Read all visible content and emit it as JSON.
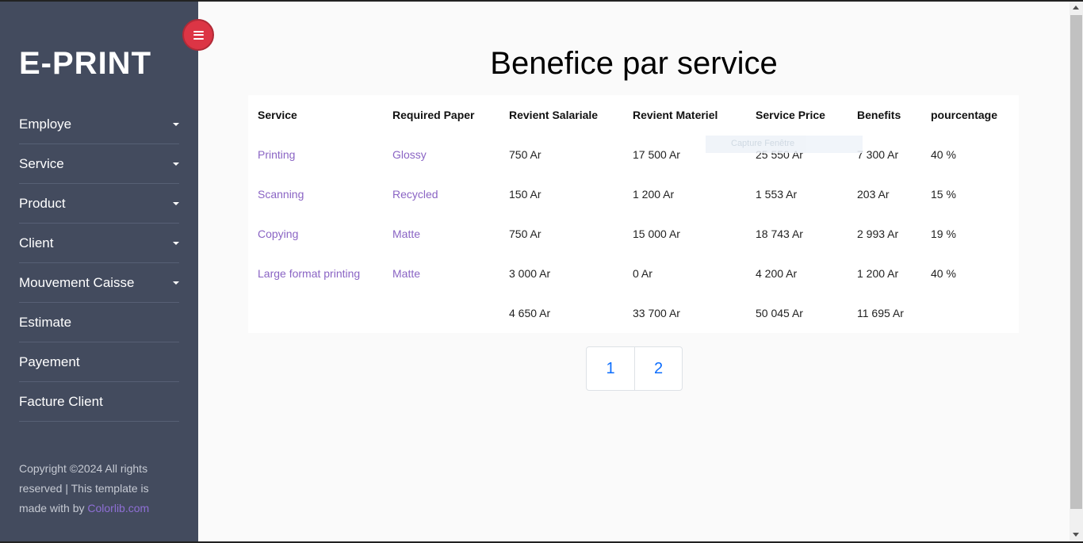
{
  "sidebar": {
    "brand": "E-PRINT",
    "items": [
      {
        "label": "Employe",
        "dropdown": true
      },
      {
        "label": "Service",
        "dropdown": true
      },
      {
        "label": "Product",
        "dropdown": true
      },
      {
        "label": "Client",
        "dropdown": true
      },
      {
        "label": "Mouvement Caisse",
        "dropdown": true
      },
      {
        "label": "Estimate",
        "dropdown": false
      },
      {
        "label": "Payement",
        "dropdown": false
      },
      {
        "label": "Facture Client",
        "dropdown": false
      }
    ],
    "footer": {
      "text": "Copyright ©2024 All rights reserved | This template is made with by",
      "link": "Colorlib.com"
    }
  },
  "main": {
    "title": "Benefice par service",
    "overlay_text": "Capture Fenêtre",
    "table": {
      "headers": [
        "Service",
        "Required Paper",
        "Revient Salariale",
        "Revient Materiel",
        "Service Price",
        "Benefits",
        "pourcentage"
      ],
      "rows": [
        [
          "Printing",
          "Glossy",
          "750 Ar",
          "17 500 Ar",
          "25 550 Ar",
          "7 300 Ar",
          "40 %"
        ],
        [
          "Scanning",
          "Recycled",
          "150 Ar",
          "1 200 Ar",
          "1 553 Ar",
          "203 Ar",
          "15 %"
        ],
        [
          "Copying",
          "Matte",
          "750 Ar",
          "15 000 Ar",
          "18 743 Ar",
          "2 993 Ar",
          "19 %"
        ],
        [
          "Large format printing",
          "Matte",
          "3 000 Ar",
          "0 Ar",
          "4 200 Ar",
          "1 200 Ar",
          "40 %"
        ]
      ],
      "totals": [
        "",
        "",
        "4 650 Ar",
        "33 700 Ar",
        "50 045 Ar",
        "11 695 Ar",
        ""
      ]
    },
    "pagination": [
      "1",
      "2"
    ]
  },
  "colors": {
    "sidebar_bg": "#434b5e",
    "toggle_btn": "#dc3545",
    "link": "#8a64c4",
    "page_link": "#0d6efd"
  },
  "icons": {
    "toggle": "hamburger-icon",
    "dropdown": "caret-down-icon"
  }
}
